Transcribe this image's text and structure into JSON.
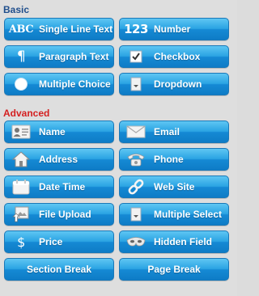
{
  "sections": {
    "basic": "Basic",
    "advanced": "Advanced"
  },
  "basic": {
    "single_line_text": "Single Line Text",
    "number": "Number",
    "paragraph_text": "Paragraph Text",
    "checkbox": "Checkbox",
    "multiple_choice": "Multiple Choice",
    "dropdown": "Dropdown",
    "abc_glyph": "ABC",
    "num_glyph": "123",
    "para_glyph": "¶"
  },
  "advanced": {
    "name": "Name",
    "email": "Email",
    "address": "Address",
    "phone": "Phone",
    "date_time": "Date Time",
    "web_site": "Web Site",
    "file_upload": "File Upload",
    "multiple_select": "Multiple Select",
    "price": "Price",
    "hidden_field": "Hidden Field",
    "section_break": "Section Break",
    "page_break": "Page Break",
    "dollar_glyph": "$"
  },
  "colors": {
    "basic_title": "#1f4e8c",
    "advanced_title": "#d42020",
    "button_blue": "#1589d4"
  }
}
